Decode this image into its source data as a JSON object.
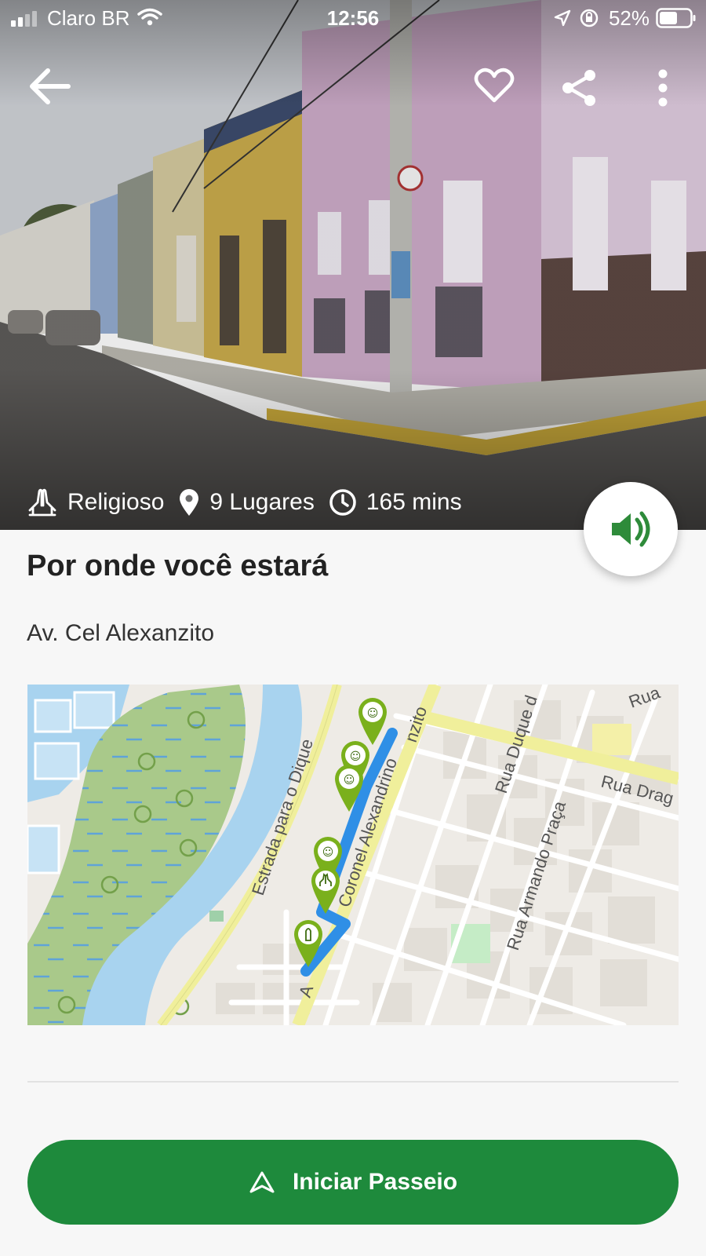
{
  "status_bar": {
    "carrier": "Claro BR",
    "time": "12:56",
    "battery": "52%"
  },
  "header": {
    "back_icon": "arrow-left-icon",
    "favorite_icon": "heart-outline-icon",
    "share_icon": "share-icon",
    "menu_icon": "more-vertical-icon"
  },
  "tour_meta": {
    "category": "Religioso",
    "places": "9 Lugares",
    "duration": "165 mins"
  },
  "section": {
    "title": "Por onde você estará",
    "address": "Av. Cel Alexanzito"
  },
  "map": {
    "labels": {
      "road_dique": "Estrada para o Dique",
      "road_alexandrino": "Coronel Alexandrino",
      "road_alexanzito": "nzito",
      "road_duque": "Rua Duque d",
      "road_armando": "Rua Armando Praça",
      "road_drag": "Rua Drag",
      "road_rua": "Rua",
      "road_a": "A"
    },
    "route_color": "#2f8fe6",
    "marker_color": "#7ab01c"
  },
  "actions": {
    "start_tour": "Iniciar Passeio"
  },
  "colors": {
    "primary_green": "#1e8a3c",
    "audio_icon": "#2e8b3a"
  }
}
